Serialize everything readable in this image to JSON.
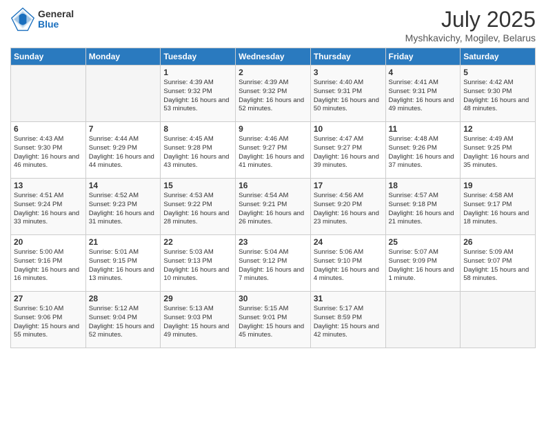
{
  "header": {
    "logo_general": "General",
    "logo_blue": "Blue",
    "title": "July 2025",
    "location": "Myshkavichy, Mogilev, Belarus"
  },
  "weekdays": [
    "Sunday",
    "Monday",
    "Tuesday",
    "Wednesday",
    "Thursday",
    "Friday",
    "Saturday"
  ],
  "weeks": [
    [
      {
        "day": "",
        "info": ""
      },
      {
        "day": "",
        "info": ""
      },
      {
        "day": "1",
        "info": "Sunrise: 4:39 AM\nSunset: 9:32 PM\nDaylight: 16 hours and 53 minutes."
      },
      {
        "day": "2",
        "info": "Sunrise: 4:39 AM\nSunset: 9:32 PM\nDaylight: 16 hours and 52 minutes."
      },
      {
        "day": "3",
        "info": "Sunrise: 4:40 AM\nSunset: 9:31 PM\nDaylight: 16 hours and 50 minutes."
      },
      {
        "day": "4",
        "info": "Sunrise: 4:41 AM\nSunset: 9:31 PM\nDaylight: 16 hours and 49 minutes."
      },
      {
        "day": "5",
        "info": "Sunrise: 4:42 AM\nSunset: 9:30 PM\nDaylight: 16 hours and 48 minutes."
      }
    ],
    [
      {
        "day": "6",
        "info": "Sunrise: 4:43 AM\nSunset: 9:30 PM\nDaylight: 16 hours and 46 minutes."
      },
      {
        "day": "7",
        "info": "Sunrise: 4:44 AM\nSunset: 9:29 PM\nDaylight: 16 hours and 44 minutes."
      },
      {
        "day": "8",
        "info": "Sunrise: 4:45 AM\nSunset: 9:28 PM\nDaylight: 16 hours and 43 minutes."
      },
      {
        "day": "9",
        "info": "Sunrise: 4:46 AM\nSunset: 9:27 PM\nDaylight: 16 hours and 41 minutes."
      },
      {
        "day": "10",
        "info": "Sunrise: 4:47 AM\nSunset: 9:27 PM\nDaylight: 16 hours and 39 minutes."
      },
      {
        "day": "11",
        "info": "Sunrise: 4:48 AM\nSunset: 9:26 PM\nDaylight: 16 hours and 37 minutes."
      },
      {
        "day": "12",
        "info": "Sunrise: 4:49 AM\nSunset: 9:25 PM\nDaylight: 16 hours and 35 minutes."
      }
    ],
    [
      {
        "day": "13",
        "info": "Sunrise: 4:51 AM\nSunset: 9:24 PM\nDaylight: 16 hours and 33 minutes."
      },
      {
        "day": "14",
        "info": "Sunrise: 4:52 AM\nSunset: 9:23 PM\nDaylight: 16 hours and 31 minutes."
      },
      {
        "day": "15",
        "info": "Sunrise: 4:53 AM\nSunset: 9:22 PM\nDaylight: 16 hours and 28 minutes."
      },
      {
        "day": "16",
        "info": "Sunrise: 4:54 AM\nSunset: 9:21 PM\nDaylight: 16 hours and 26 minutes."
      },
      {
        "day": "17",
        "info": "Sunrise: 4:56 AM\nSunset: 9:20 PM\nDaylight: 16 hours and 23 minutes."
      },
      {
        "day": "18",
        "info": "Sunrise: 4:57 AM\nSunset: 9:18 PM\nDaylight: 16 hours and 21 minutes."
      },
      {
        "day": "19",
        "info": "Sunrise: 4:58 AM\nSunset: 9:17 PM\nDaylight: 16 hours and 18 minutes."
      }
    ],
    [
      {
        "day": "20",
        "info": "Sunrise: 5:00 AM\nSunset: 9:16 PM\nDaylight: 16 hours and 16 minutes."
      },
      {
        "day": "21",
        "info": "Sunrise: 5:01 AM\nSunset: 9:15 PM\nDaylight: 16 hours and 13 minutes."
      },
      {
        "day": "22",
        "info": "Sunrise: 5:03 AM\nSunset: 9:13 PM\nDaylight: 16 hours and 10 minutes."
      },
      {
        "day": "23",
        "info": "Sunrise: 5:04 AM\nSunset: 9:12 PM\nDaylight: 16 hours and 7 minutes."
      },
      {
        "day": "24",
        "info": "Sunrise: 5:06 AM\nSunset: 9:10 PM\nDaylight: 16 hours and 4 minutes."
      },
      {
        "day": "25",
        "info": "Sunrise: 5:07 AM\nSunset: 9:09 PM\nDaylight: 16 hours and 1 minute."
      },
      {
        "day": "26",
        "info": "Sunrise: 5:09 AM\nSunset: 9:07 PM\nDaylight: 15 hours and 58 minutes."
      }
    ],
    [
      {
        "day": "27",
        "info": "Sunrise: 5:10 AM\nSunset: 9:06 PM\nDaylight: 15 hours and 55 minutes."
      },
      {
        "day": "28",
        "info": "Sunrise: 5:12 AM\nSunset: 9:04 PM\nDaylight: 15 hours and 52 minutes."
      },
      {
        "day": "29",
        "info": "Sunrise: 5:13 AM\nSunset: 9:03 PM\nDaylight: 15 hours and 49 minutes."
      },
      {
        "day": "30",
        "info": "Sunrise: 5:15 AM\nSunset: 9:01 PM\nDaylight: 15 hours and 45 minutes."
      },
      {
        "day": "31",
        "info": "Sunrise: 5:17 AM\nSunset: 8:59 PM\nDaylight: 15 hours and 42 minutes."
      },
      {
        "day": "",
        "info": ""
      },
      {
        "day": "",
        "info": ""
      }
    ]
  ]
}
